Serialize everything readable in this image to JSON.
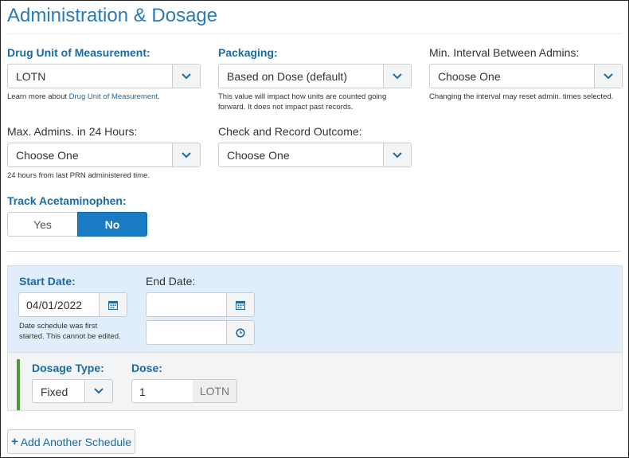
{
  "page": {
    "title": "Administration & Dosage"
  },
  "drug_unit": {
    "label": "Drug Unit of Measurement:",
    "value": "LOTN",
    "help_prefix": "Learn more about ",
    "help_link": "Drug Unit of Measurement",
    "help_suffix": "."
  },
  "packaging": {
    "label": "Packaging:",
    "value": "Based on Dose (default)",
    "help_line1": "This value will impact how units are counted going",
    "help_line2": "forward. It does not impact past records."
  },
  "min_interval": {
    "label": "Min. Interval Between Admins:",
    "value": "Choose One",
    "help": "Changing the interval may reset admin. times selected."
  },
  "max_admins": {
    "label": "Max. Admins. in 24 Hours:",
    "value": "Choose One",
    "help": "24 hours from last PRN administered time."
  },
  "check_outcome": {
    "label": "Check and Record Outcome:",
    "value": "Choose One"
  },
  "track_acetaminophen": {
    "label": "Track Acetaminophen:",
    "options": [
      "Yes",
      "No"
    ],
    "selected": "No"
  },
  "schedule": {
    "start_date_label": "Start Date:",
    "start_date_value": "04/01/2022",
    "start_help_line1": "Date schedule was first",
    "start_help_line2": "started. This cannot be edited.",
    "end_date_label": "End Date:",
    "end_date_value": "",
    "end_time_value": ""
  },
  "dosage": {
    "type_label": "Dosage Type:",
    "type_value": "Fixed",
    "dose_label": "Dose:",
    "dose_value": "1",
    "dose_unit": "LOTN"
  },
  "add_schedule_button": "Add Another Schedule",
  "colors": {
    "accent": "#1a7bc4",
    "label_blue": "#1a6aa5",
    "schedule_bg": "#dfeefa",
    "green_bar": "#4a9a3a"
  }
}
